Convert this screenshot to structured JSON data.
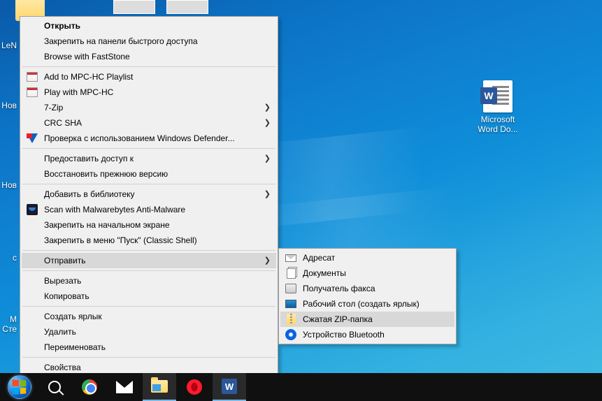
{
  "desktop": {
    "left_labels": [
      "LeN",
      "Нов",
      "Нов",
      "с",
      "М\nСте"
    ],
    "word_icon_label": "Microsoft\nWord Do..."
  },
  "context_main": {
    "groups": [
      [
        {
          "label": "Открыть",
          "bold": true
        },
        {
          "label": "Закрепить на панели быстрого доступа"
        },
        {
          "label": "Browse with FastStone"
        }
      ],
      [
        {
          "label": "Add to MPC-HC Playlist",
          "icon": "cal"
        },
        {
          "label": "Play with MPC-HC",
          "icon": "cal"
        },
        {
          "label": "7-Zip",
          "submenu": true
        },
        {
          "label": "CRC SHA",
          "submenu": true
        },
        {
          "label": "Проверка с использованием Windows Defender...",
          "icon": "shield"
        }
      ],
      [
        {
          "label": "Предоставить доступ к",
          "submenu": true
        },
        {
          "label": "Восстановить прежнюю версию"
        }
      ],
      [
        {
          "label": "Добавить в библиотеку",
          "submenu": true
        },
        {
          "label": "Scan with Malwarebytes Anti-Malware",
          "icon": "mbam"
        },
        {
          "label": "Закрепить на начальном экране"
        },
        {
          "label": "Закрепить в меню \"Пуск\" (Classic Shell)"
        }
      ],
      [
        {
          "label": "Отправить",
          "submenu": true,
          "highlight": true
        }
      ],
      [
        {
          "label": "Вырезать"
        },
        {
          "label": "Копировать"
        }
      ],
      [
        {
          "label": "Создать ярлык"
        },
        {
          "label": "Удалить"
        },
        {
          "label": "Переименовать"
        }
      ],
      [
        {
          "label": "Свойства"
        }
      ]
    ]
  },
  "context_sub": {
    "items": [
      {
        "label": "Адресат",
        "icon": "mail"
      },
      {
        "label": "Документы",
        "icon": "docs"
      },
      {
        "label": "Получатель факса",
        "icon": "fax"
      },
      {
        "label": "Рабочий стол (создать ярлык)",
        "icon": "desk"
      },
      {
        "label": "Сжатая ZIP-папка",
        "icon": "zip",
        "highlight": true
      },
      {
        "label": "Устройство Bluetooth",
        "icon": "bt"
      }
    ]
  },
  "taskbar": {
    "buttons": [
      {
        "name": "start",
        "icon": "start"
      },
      {
        "name": "search",
        "icon": "search"
      },
      {
        "name": "chrome",
        "icon": "chrome"
      },
      {
        "name": "mail",
        "icon": "mail"
      },
      {
        "name": "explorer",
        "icon": "explorer",
        "active": true
      },
      {
        "name": "opera",
        "icon": "opera"
      },
      {
        "name": "word",
        "icon": "word",
        "active": true
      }
    ]
  }
}
